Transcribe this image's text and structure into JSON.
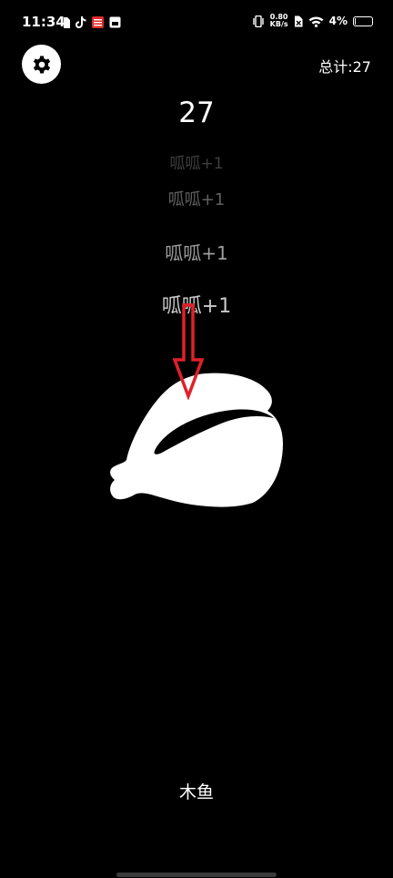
{
  "status_bar": {
    "time": "11:34",
    "net_speed_value": "0.80",
    "net_speed_unit": "KB/s",
    "battery_percent": "4%",
    "battery_level": 0.04,
    "left_icons": [
      "sim-icon",
      "tiktok-icon",
      "app-red-icon",
      "app-calendar-icon"
    ],
    "right_icons": [
      "vibrate-icon",
      "sim-off-icon",
      "wifi-icon",
      "battery-icon"
    ]
  },
  "header": {
    "settings_icon": "gear-icon",
    "total_label": "总计:27"
  },
  "counter": {
    "value": "27"
  },
  "floating_texts": [
    "呱呱+1",
    "呱呱+1",
    "呱呱+1",
    "呱呱+1"
  ],
  "woodfish": {
    "icon": "woodfish-icon",
    "label": "木鱼"
  },
  "annotation": {
    "icon": "red-down-arrow-icon",
    "color": "#e0202a"
  },
  "colors": {
    "background": "#000000",
    "foreground": "#ffffff"
  }
}
